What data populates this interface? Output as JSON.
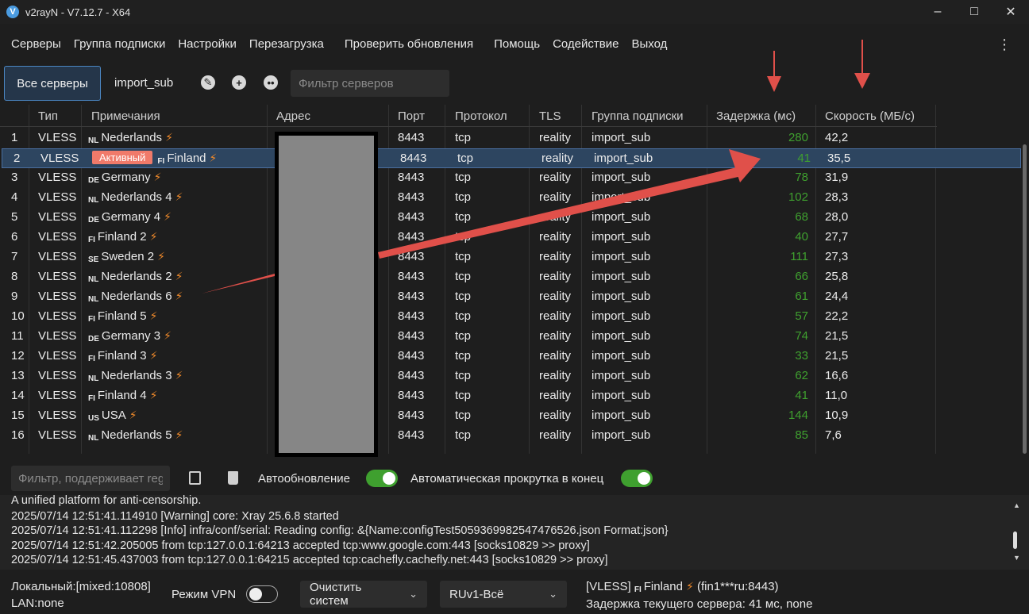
{
  "window": {
    "title": "v2rayN - V7.12.7 - X64"
  },
  "menu": [
    "Серверы",
    "Группа подписки",
    "Настройки",
    "Перезагрузка",
    "Проверить обновления",
    "Помощь",
    "Содействие",
    "Выход"
  ],
  "toolbar": {
    "all_servers": "Все серверы",
    "sub_tab": "import_sub",
    "filter_placeholder": "Фильтр серверов"
  },
  "columns": [
    "Тип",
    "Примечания",
    "Адрес",
    "Порт",
    "Протокол",
    "TLS",
    "Группа подписки",
    "Задержка (мс)",
    "Скорость (МБ/с)"
  ],
  "active_badge": "Активный",
  "rows": [
    {
      "n": "1",
      "type": "VLESS",
      "flag": "NL",
      "remark": "Nederlands",
      "port": "8443",
      "proto": "tcp",
      "tls": "reality",
      "group": "import_sub",
      "delay": "280",
      "speed": "42,2"
    },
    {
      "n": "2",
      "type": "VLESS",
      "flag": "FI",
      "remark": "Finland",
      "port": "8443",
      "proto": "tcp",
      "tls": "reality",
      "group": "import_sub",
      "delay": "41",
      "speed": "35,5",
      "active": true
    },
    {
      "n": "3",
      "type": "VLESS",
      "flag": "DE",
      "remark": "Germany",
      "port": "8443",
      "proto": "tcp",
      "tls": "reality",
      "group": "import_sub",
      "delay": "78",
      "speed": "31,9"
    },
    {
      "n": "4",
      "type": "VLESS",
      "flag": "NL",
      "remark": "Nederlands  4",
      "port": "8443",
      "proto": "tcp",
      "tls": "reality",
      "group": "import_sub",
      "delay": "102",
      "speed": "28,3"
    },
    {
      "n": "5",
      "type": "VLESS",
      "flag": "DE",
      "remark": "Germany 4",
      "port": "8443",
      "proto": "tcp",
      "tls": "reality",
      "group": "import_sub",
      "delay": "68",
      "speed": "28,0"
    },
    {
      "n": "6",
      "type": "VLESS",
      "flag": "FI",
      "remark": "Finland 2",
      "port": "8443",
      "proto": "tcp",
      "tls": "reality",
      "group": "import_sub",
      "delay": "40",
      "speed": "27,7"
    },
    {
      "n": "7",
      "type": "VLESS",
      "flag": "SE",
      "remark": "Sweden 2",
      "port": "8443",
      "proto": "tcp",
      "tls": "reality",
      "group": "import_sub",
      "delay": "111",
      "speed": "27,3"
    },
    {
      "n": "8",
      "type": "VLESS",
      "flag": "NL",
      "remark": "Nederlands  2",
      "port": "8443",
      "proto": "tcp",
      "tls": "reality",
      "group": "import_sub",
      "delay": "66",
      "speed": "25,8"
    },
    {
      "n": "9",
      "type": "VLESS",
      "flag": "NL",
      "remark": "Nederlands  6",
      "port": "8443",
      "proto": "tcp",
      "tls": "reality",
      "group": "import_sub",
      "delay": "61",
      "speed": "24,4"
    },
    {
      "n": "10",
      "type": "VLESS",
      "flag": "FI",
      "remark": "Finland 5",
      "port": "8443",
      "proto": "tcp",
      "tls": "reality",
      "group": "import_sub",
      "delay": "57",
      "speed": "22,2"
    },
    {
      "n": "11",
      "type": "VLESS",
      "flag": "DE",
      "remark": "Germany 3",
      "port": "8443",
      "proto": "tcp",
      "tls": "reality",
      "group": "import_sub",
      "delay": "74",
      "speed": "21,5"
    },
    {
      "n": "12",
      "type": "VLESS",
      "flag": "FI",
      "remark": "Finland 3",
      "port": "8443",
      "proto": "tcp",
      "tls": "reality",
      "group": "import_sub",
      "delay": "33",
      "speed": "21,5"
    },
    {
      "n": "13",
      "type": "VLESS",
      "flag": "NL",
      "remark": "Nederlands  3",
      "port": "8443",
      "proto": "tcp",
      "tls": "reality",
      "group": "import_sub",
      "delay": "62",
      "speed": "16,6"
    },
    {
      "n": "14",
      "type": "VLESS",
      "flag": "FI",
      "remark": "Finland 4",
      "port": "8443",
      "proto": "tcp",
      "tls": "reality",
      "group": "import_sub",
      "delay": "41",
      "speed": "11,0"
    },
    {
      "n": "15",
      "type": "VLESS",
      "flag": "US",
      "remark": "USA",
      "port": "8443",
      "proto": "tcp",
      "tls": "reality",
      "group": "import_sub",
      "delay": "144",
      "speed": "10,9"
    },
    {
      "n": "16",
      "type": "VLESS",
      "flag": "NL",
      "remark": "Nederlands  5",
      "port": "8443",
      "proto": "tcp",
      "tls": "reality",
      "group": "import_sub",
      "delay": "85",
      "speed": "7,6"
    }
  ],
  "logbar": {
    "filter_placeholder": "Фильтр, поддерживает regex",
    "auto_refresh": "Автообновление",
    "auto_scroll": "Автоматическая прокрутка в конец"
  },
  "log_lines": [
    "A unified platform for anti-censorship.",
    "2025/07/14 12:51:41.114910 [Warning] core: Xray 25.6.8 started",
    "2025/07/14 12:51:41.112298 [Info] infra/conf/serial: Reading config: &{Name:configTest505936998254747652​6.json Format:json}",
    "2025/07/14 12:51:42.205005 from tcp:127.0.0.1:64213 accepted tcp:www.google.com:443 [socks10829 >> proxy]",
    "2025/07/14 12:51:45.437003 from tcp:127.0.0.1:64215 accepted tcp:cachefly.cachefly.net:443 [socks10829 >> proxy]"
  ],
  "status": {
    "local": "Локальный:[mixed:10808]",
    "lan": "LAN:none",
    "vpn_mode": "Режим VPN",
    "clear_proxy": "Очистить систем",
    "routing": "RUv1-Всё",
    "server_prefix": "[VLESS]",
    "server_flag": "FI",
    "server_name": "Finland",
    "server_addr": "(fin1***ru:8443)",
    "latency": "Задержка текущего сервера: 41 мс, none"
  }
}
